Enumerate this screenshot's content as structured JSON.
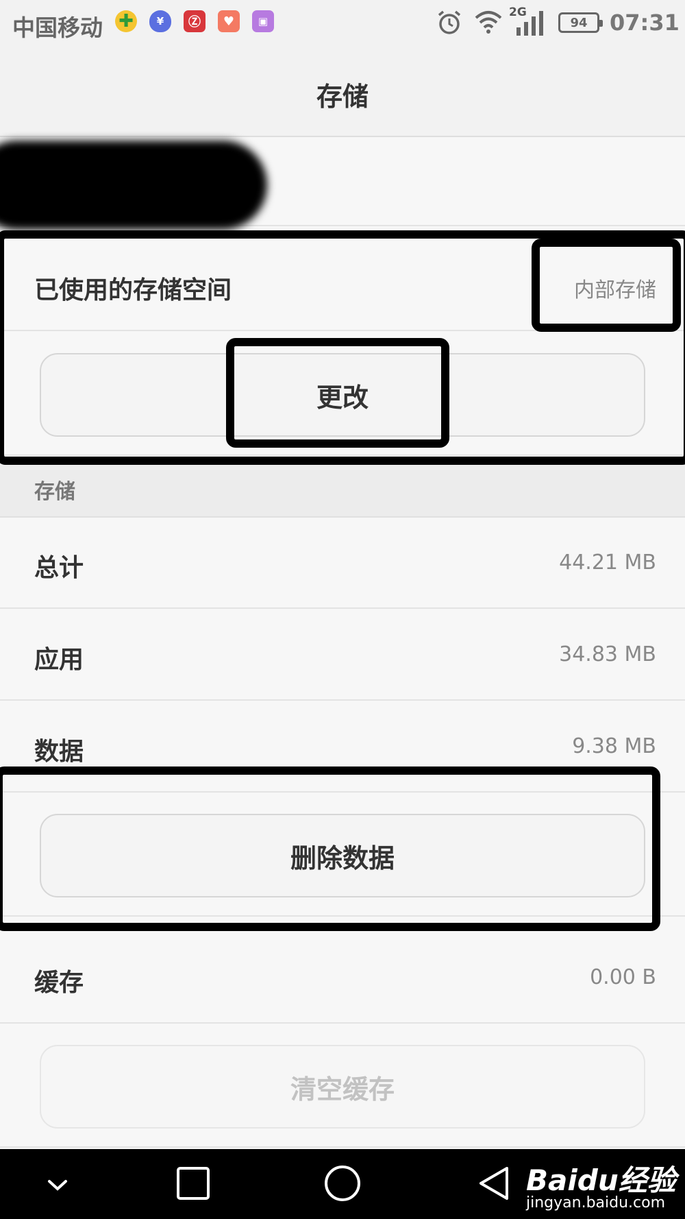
{
  "status_bar": {
    "carrier": "中国移动",
    "network_type": "2G",
    "battery_level": "94",
    "time": "07:31"
  },
  "header": {
    "title": "存储"
  },
  "storage_location": {
    "label": "已使用的存储空间",
    "value": "内部存储",
    "change_button": "更改"
  },
  "storage_section": {
    "header": "存储",
    "rows": [
      {
        "label": "总计",
        "value": "44.21 MB"
      },
      {
        "label": "应用",
        "value": "34.83 MB"
      },
      {
        "label": "数据",
        "value": "9.38 MB"
      }
    ],
    "delete_data_button": "删除数据"
  },
  "cache_section": {
    "label": "缓存",
    "value": "0.00 B",
    "clear_cache_button": "清空缓存"
  },
  "watermark": {
    "logo": "Baidu经验",
    "url": "jingyan.baidu.com"
  },
  "icons": [
    "alarm-icon",
    "wifi-icon",
    "signal-icon",
    "battery-icon",
    "nav-collapse-icon",
    "nav-recent-icon",
    "nav-home-icon",
    "nav-back-icon"
  ],
  "colors": {
    "background": "#f7f7f7",
    "title_bar": "#f2f2f2",
    "nav_bar": "#000000",
    "annotation": "#000000"
  }
}
